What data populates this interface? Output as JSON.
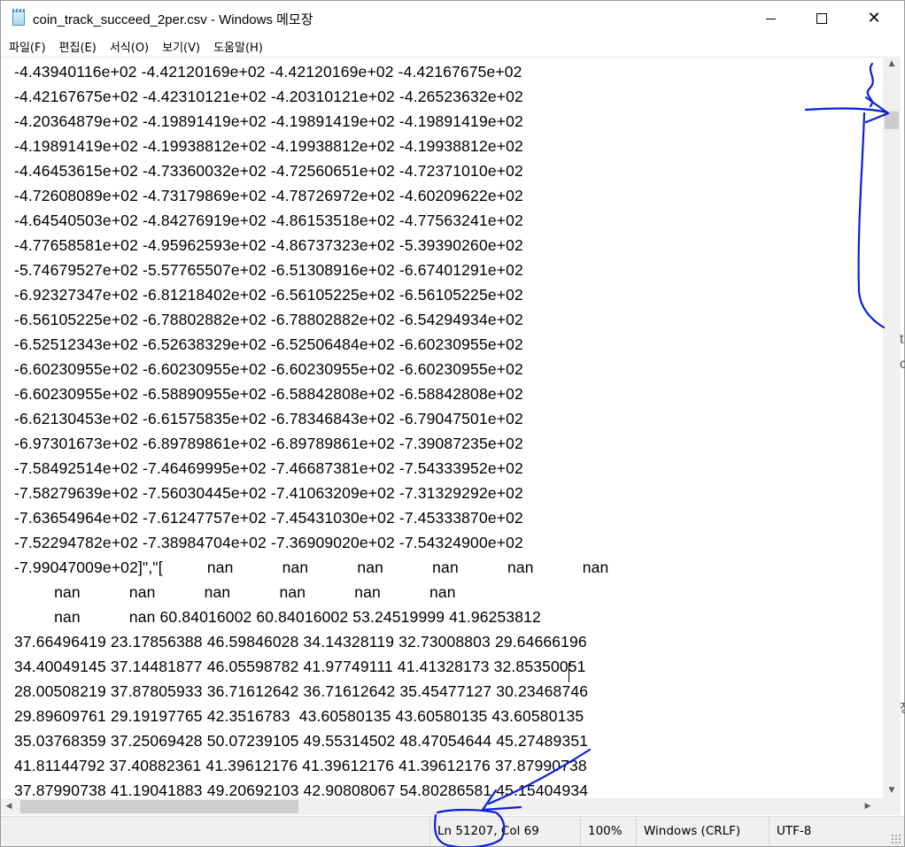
{
  "window": {
    "title": "coin_track_succeed_2per.csv - Windows 메모장",
    "icon": "notepad-icon",
    "controls": {
      "minimize_icon": "minimize-icon",
      "maximize_icon": "maximize-icon",
      "close_icon": "close-icon",
      "close_glyph": "✕"
    }
  },
  "menu": [
    {
      "label": "파일(F)"
    },
    {
      "label": "편집(E)"
    },
    {
      "label": "서식(O)"
    },
    {
      "label": "보기(V)"
    },
    {
      "label": "도움말(H)"
    }
  ],
  "editor": {
    "lines": [
      "-4.43940116e+02 -4.42120169e+02 -4.42120169e+02 -4.42167675e+02",
      "-4.42167675e+02 -4.42310121e+02 -4.20310121e+02 -4.26523632e+02",
      "-4.20364879e+02 -4.19891419e+02 -4.19891419e+02 -4.19891419e+02",
      "-4.19891419e+02 -4.19938812e+02 -4.19938812e+02 -4.19938812e+02",
      "-4.46453615e+02 -4.73360032e+02 -4.72560651e+02 -4.72371010e+02",
      "-4.72608089e+02 -4.73179869e+02 -4.78726972e+02 -4.60209622e+02",
      "-4.64540503e+02 -4.84276919e+02 -4.86153518e+02 -4.77563241e+02",
      "-4.77658581e+02 -4.95962593e+02 -4.86737323e+02 -5.39390260e+02",
      "-5.74679527e+02 -5.57765507e+02 -6.51308916e+02 -6.67401291e+02",
      "-6.92327347e+02 -6.81218402e+02 -6.56105225e+02 -6.56105225e+02",
      "-6.56105225e+02 -6.78802882e+02 -6.78802882e+02 -6.54294934e+02",
      "-6.52512343e+02 -6.52638329e+02 -6.52506484e+02 -6.60230955e+02",
      "-6.60230955e+02 -6.60230955e+02 -6.60230955e+02 -6.60230955e+02",
      "-6.60230955e+02 -6.58890955e+02 -6.58842808e+02 -6.58842808e+02",
      "-6.62130453e+02 -6.61575835e+02 -6.78346843e+02 -6.79047501e+02",
      "-6.97301673e+02 -6.89789861e+02 -6.89789861e+02 -7.39087235e+02",
      "-7.58492514e+02 -7.46469995e+02 -7.46687381e+02 -7.54333952e+02",
      "-7.58279639e+02 -7.56030445e+02 -7.41063209e+02 -7.31329292e+02",
      "-7.63654964e+02 -7.61247757e+02 -7.45431030e+02 -7.45333870e+02",
      "-7.52294782e+02 -7.38984704e+02 -7.36909020e+02 -7.54324900e+02",
      "-7.99047009e+02]\",\"[          nan           nan           nan           nan           nan           nan",
      "         nan           nan           nan           nan           nan           nan",
      "         nan           nan 60.84016002 60.84016002 53.24519999 41.96253812",
      "37.66496419 23.17856388 46.59846028 34.14328119 32.73008803 29.64666196",
      "34.40049145 37.14481877 46.05598782 41.97749111 41.41328173 32.85350051",
      "28.00508219 37.87805933 36.71612642 36.71612642 35.45477127 30.23468746",
      "29.89609761 29.19197765 42.3516783  43.60580135 43.60580135 43.60580135",
      "35.03768359 37.25069428 50.07239105 49.55314502 48.47054644 45.27489351",
      "41.81144792 37.40882361 41.39612176 41.39612176 41.39612176 37.87990738",
      "37.87990738 41.19041883 49.20692103 42.90808067 54.80286581 45.15404934"
    ]
  },
  "status": {
    "position": "Ln 51207, Col 69",
    "zoom": "100%",
    "line_ending": "Windows (CRLF)",
    "encoding": "UTF-8"
  },
  "background_fragments": [
    "t",
    "c",
    "장"
  ],
  "colors": {
    "annotation": "#0a1fd6",
    "scroll_thumb": "#cdcdcd",
    "status_bg": "#f0f0f0"
  }
}
